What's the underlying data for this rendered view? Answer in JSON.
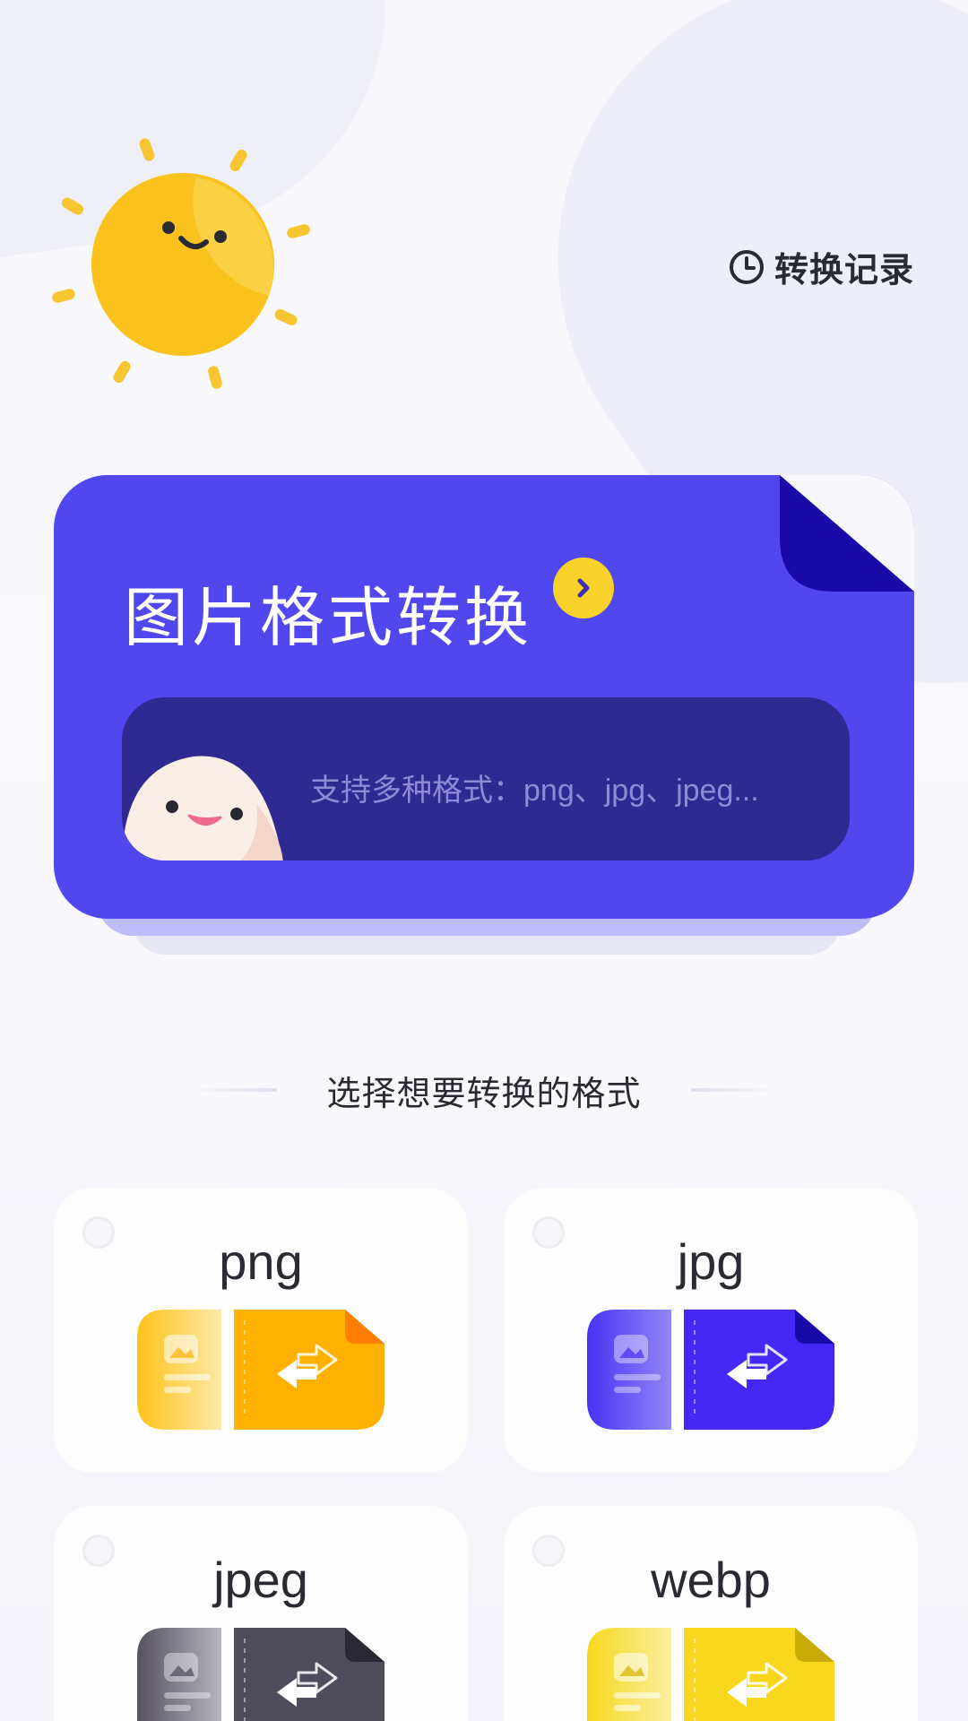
{
  "header": {
    "history_label": "转换记录",
    "history_icon": "clock-icon"
  },
  "hero": {
    "title": "图片格式转换",
    "arrow_icon": "chevron-right-icon",
    "subtitle": "支持多种格式：png、jpg、jpeg...",
    "color": "#5147ee"
  },
  "section": {
    "title": "选择想要转换的格式"
  },
  "formats": [
    {
      "label": "png",
      "selected": false,
      "color": "#ffb000"
    },
    {
      "label": "jpg",
      "selected": false,
      "color": "#4a32f5"
    },
    {
      "label": "jpeg",
      "selected": false,
      "color": "#4f4c5c"
    },
    {
      "label": "webp",
      "selected": false,
      "color": "#f7d81c"
    }
  ]
}
